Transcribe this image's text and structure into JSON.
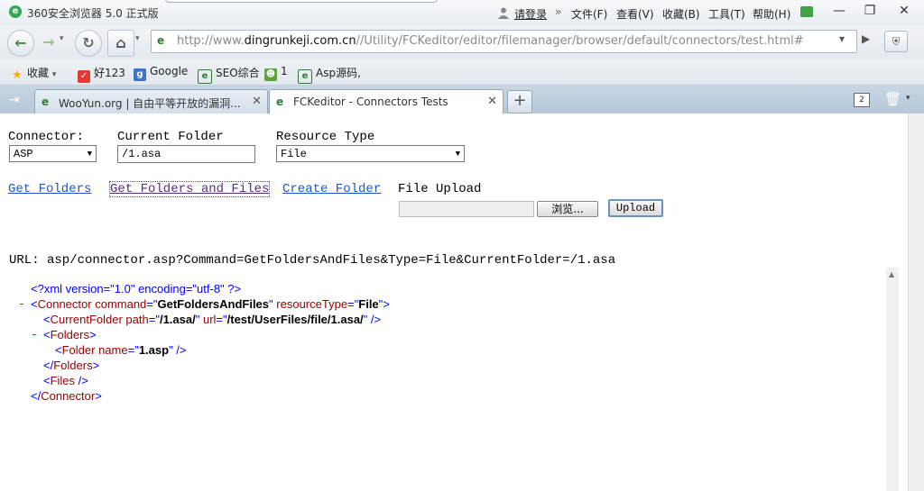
{
  "browser": {
    "title": "360安全浏览器 5.0 正式版",
    "login": "请登录",
    "menu": [
      "文件(F)",
      "查看(V)",
      "收藏(B)",
      "工具(T)",
      "帮助(H)"
    ],
    "url_prefix": "http://www.",
    "url_domain": "dingrunkeji.com.cn",
    "url_path": "//Utility/FCKeditor/editor/filemanager/browser/default/connectors/test.html#",
    "bookmarks": [
      "收藏",
      "好123",
      "Google",
      "SEO综合",
      "1",
      "Asp源码,"
    ],
    "tabs": [
      {
        "label": "WooYun.org | 自由平等开放的漏洞...",
        "active": false
      },
      {
        "label": "FCKeditor - Connectors Tests",
        "active": true
      }
    ],
    "tab_count": "2"
  },
  "form": {
    "connector_label": "Connector:",
    "connector_value": "ASP",
    "folder_label": "Current Folder",
    "folder_value": "/1.asa",
    "resource_label": "Resource Type",
    "resource_value": "File"
  },
  "links": {
    "get_folders": "Get Folders",
    "get_folders_files": "Get Folders and Files",
    "create_folder": "Create Folder",
    "file_upload": "File Upload",
    "browse": "浏览...",
    "upload": "Upload"
  },
  "url_line": "URL: asp/connector.asp?Command=GetFoldersAndFiles&Type=File&CurrentFolder=/1.asa",
  "xml": {
    "decl": "<?xml version=\"1.0\" encoding=\"utf-8\" ?>",
    "connector_command": "GetFoldersAndFiles",
    "connector_resource": "File",
    "current_path": "/1.asa/",
    "current_url": "/test/UserFiles/file/1.asa/",
    "folder_name": "1.asp"
  }
}
